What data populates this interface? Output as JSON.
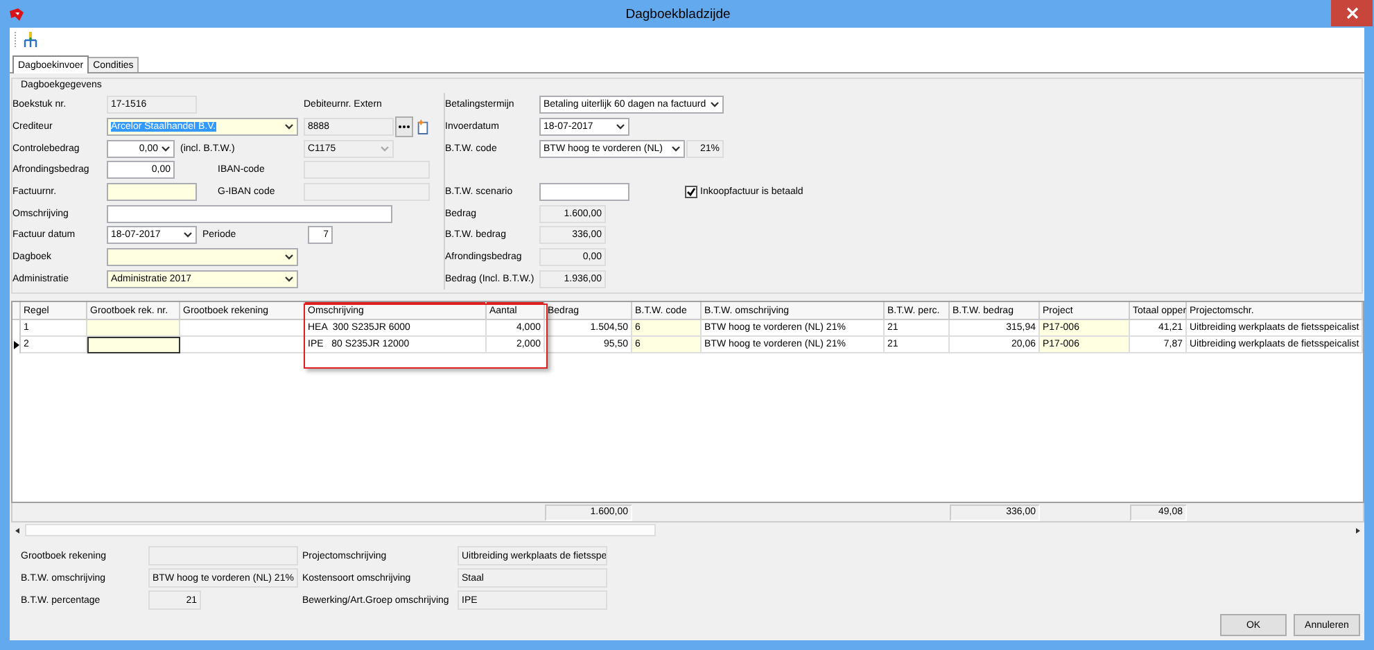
{
  "window": {
    "title": "Dagboekbladzijde"
  },
  "tabs": [
    {
      "label": "Dagboekinvoer",
      "selected": true
    },
    {
      "label": "Condities",
      "selected": false
    }
  ],
  "journal": {
    "legend": "Dagboekgegevens",
    "left_rows": [
      {
        "items": [
          {
            "kind": "label",
            "text": "Boekstuk nr."
          },
          {
            "kind": "readonly",
            "value": "17-1516"
          },
          {
            "kind": "label",
            "text": "Debiteurnr. Extern"
          }
        ]
      },
      {
        "items": [
          {
            "kind": "label",
            "text": "Crediteur"
          },
          {
            "kind": "combo",
            "value": "Arcelor Staalhandel B.V.",
            "required": true,
            "text_selected": true
          },
          {
            "kind": "readonly",
            "value": "8888"
          },
          {
            "kind": "browse-button"
          },
          {
            "kind": "new-button"
          }
        ]
      },
      {
        "items": [
          {
            "kind": "label",
            "text": "Controlebedrag"
          },
          {
            "kind": "combo-number",
            "value": "0,00",
            "required": false
          },
          {
            "kind": "label",
            "text": "(incl. B.T.W.)"
          },
          {
            "kind": "readonly-combo",
            "value": "C1175"
          }
        ]
      },
      {
        "items": [
          {
            "kind": "label",
            "text": "Afrondingsbedrag"
          },
          {
            "kind": "number",
            "value": "0,00",
            "required": false
          },
          {
            "kind": "label",
            "text": "IBAN-code"
          },
          {
            "kind": "readonly"
          }
        ]
      },
      {
        "items": [
          {
            "kind": "label",
            "text": "Factuurnr."
          },
          {
            "kind": "text",
            "required": true
          },
          {
            "kind": "label",
            "text": "G-IBAN code"
          },
          {
            "kind": "readonly"
          }
        ]
      },
      {
        "items": [
          {
            "kind": "label",
            "text": "Omschrijving"
          },
          {
            "kind": "text",
            "required": false
          }
        ]
      },
      {
        "items": [
          {
            "kind": "label",
            "text": "Factuur datum"
          },
          {
            "kind": "combo",
            "value": "18-07-2017",
            "required": false
          },
          {
            "kind": "label",
            "text": "Periode"
          },
          {
            "kind": "number",
            "value": "7",
            "required": false
          }
        ]
      },
      {
        "items": [
          {
            "kind": "label",
            "text": "Dagboek"
          },
          {
            "kind": "combo",
            "required": true
          }
        ]
      },
      {
        "items": [
          {
            "kind": "label",
            "text": "Administratie"
          },
          {
            "kind": "combo",
            "value": "Administratie 2017",
            "required": true
          }
        ]
      }
    ],
    "right_rows": [
      {
        "items": [
          {
            "kind": "label",
            "text": "Betalingstermijn"
          },
          {
            "kind": "combo",
            "value": "Betaling uiterlijk 60 dagen na factuurd",
            "required": false
          }
        ]
      },
      {
        "items": [
          {
            "kind": "label",
            "text": "Invoerdatum"
          },
          {
            "kind": "combo",
            "value": "18-07-2017",
            "required": false
          }
        ]
      },
      {
        "items": [
          {
            "kind": "label",
            "text": "B.T.W. code"
          },
          {
            "kind": "combo",
            "value": "BTW hoog te vorderen (NL)",
            "required": false
          },
          {
            "kind": "readonly-number",
            "value": "21%"
          }
        ]
      },
      {
        "items": [
          {
            "kind": "label",
            "text": "B.T.W. scenario"
          },
          {
            "kind": "text",
            "required": false
          },
          {
            "kind": "checkbox",
            "label": "Inkoopfactuur is betaald",
            "checked": true
          }
        ]
      },
      {
        "items": [
          {
            "kind": "label",
            "text": "Bedrag"
          },
          {
            "kind": "readonly-number",
            "value": "1.600,00"
          }
        ]
      },
      {
        "items": [
          {
            "kind": "label",
            "text": "B.T.W. bedrag"
          },
          {
            "kind": "readonly-number",
            "value": "336,00"
          }
        ]
      },
      {
        "items": [
          {
            "kind": "label",
            "text": "Afrondingsbedrag"
          },
          {
            "kind": "readonly-number",
            "value": "0,00"
          }
        ]
      },
      {
        "items": [
          {
            "kind": "label",
            "text": "Bedrag (Incl. B.T.W.)"
          },
          {
            "kind": "readonly-number",
            "value": "1.936,00"
          }
        ]
      }
    ]
  },
  "grid": {
    "columns": [
      {
        "title": "Regel",
        "kind": "text",
        "required": false,
        "highlighted": false
      },
      {
        "title": "Grootboek rek. nr.",
        "kind": "text",
        "required": true,
        "highlighted": false
      },
      {
        "title": "Grootboek rekening",
        "kind": "text",
        "required": false,
        "highlighted": false
      },
      {
        "title": "Omschrijving",
        "kind": "text",
        "required": false,
        "highlighted": true
      },
      {
        "title": "Aantal",
        "kind": "number",
        "required": false,
        "highlighted": true
      },
      {
        "title": "Bedrag",
        "kind": "number",
        "required": false,
        "highlighted": false,
        "total": "1.600,00"
      },
      {
        "title": "B.T.W. code",
        "kind": "text",
        "required": true,
        "highlighted": false
      },
      {
        "title": "B.T.W. omschrijving",
        "kind": "text",
        "required": false,
        "highlighted": false
      },
      {
        "title": "B.T.W. perc.",
        "kind": "text",
        "required": false,
        "highlighted": false
      },
      {
        "title": "B.T.W. bedrag",
        "kind": "number",
        "required": false,
        "highlighted": false,
        "total": "336,00"
      },
      {
        "title": "Project",
        "kind": "text",
        "required": true,
        "highlighted": false
      },
      {
        "title": "Totaal opper",
        "kind": "number",
        "required": false,
        "highlighted": false,
        "total": "49,08"
      },
      {
        "title": "Projectomschr.",
        "kind": "text",
        "required": false,
        "highlighted": false
      }
    ],
    "rows": [
      {
        "selected": false,
        "cells": [
          "1",
          null,
          null,
          "HEA  300 S235JR 6000",
          "4,000",
          "1.504,50",
          "6",
          "BTW hoog te vorderen (NL) 21%",
          "21",
          "315,94",
          "P17-006",
          "41,21",
          "Uitbreiding werkplaats de fietsspeicalist"
        ]
      },
      {
        "selected": true,
        "cells": [
          "2",
          null,
          null,
          "IPE   80 S235JR 12000",
          "2,000",
          "95,50",
          "6",
          "BTW hoog te vorderen (NL) 21%",
          "21",
          "20,06",
          "P17-006",
          "7,87",
          "Uitbreiding werkplaats de fietsspeicalist"
        ]
      }
    ]
  },
  "details": {
    "left": [
      {
        "label": "Grootboek rekening"
      },
      {
        "label": "B.T.W. omschrijving",
        "value": "BTW hoog te vorderen (NL) 21%"
      },
      {
        "label": "B.T.W. percentage",
        "value": "21"
      }
    ],
    "right": [
      {
        "label": "Projectomschrijving",
        "value": "Uitbreiding werkplaats de fietsspe"
      },
      {
        "label": "Kostensoort omschrijving",
        "value": "Staal"
      },
      {
        "label": "Bewerking/Art.Groep omschrijving",
        "value": "IPE"
      }
    ]
  },
  "buttons": [
    {
      "label": "OK"
    },
    {
      "label": "Annuleren"
    }
  ]
}
